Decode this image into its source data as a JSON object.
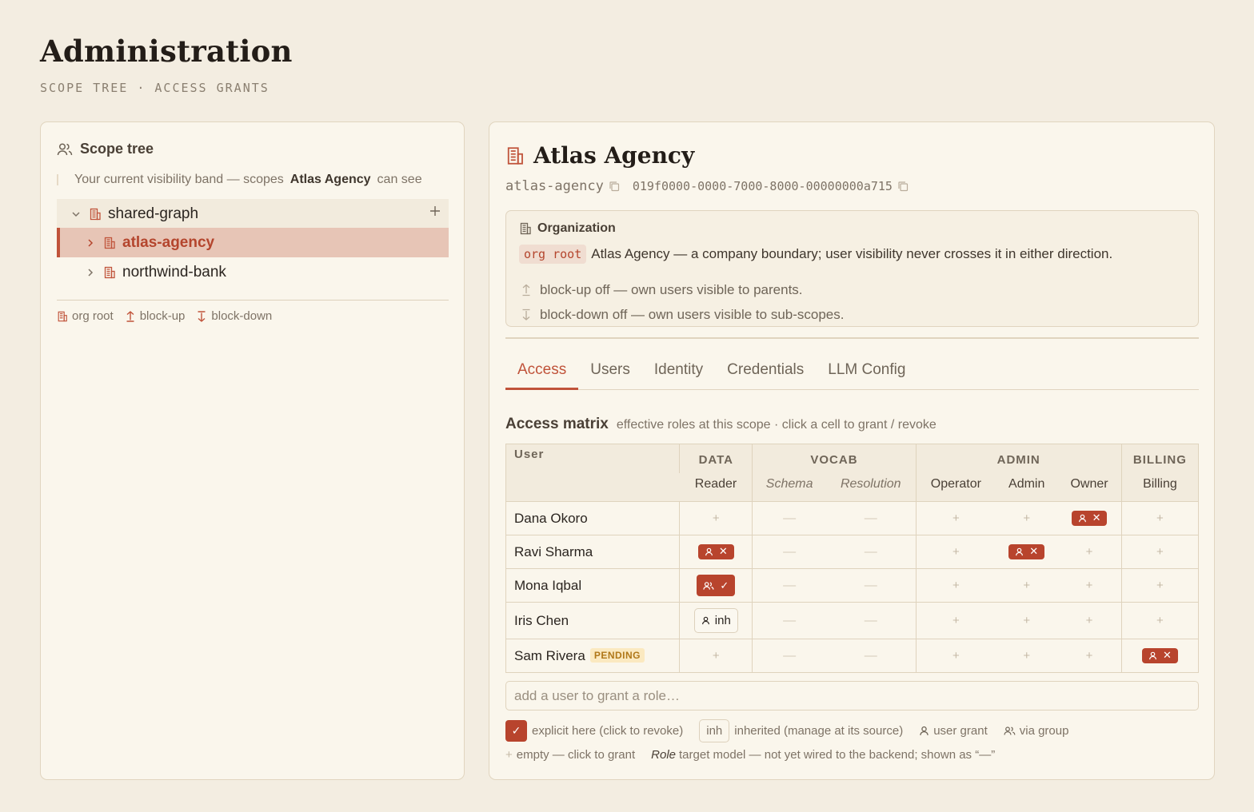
{
  "page": {
    "title": "Administration",
    "subtitle": "SCOPE TREE · ACCESS GRANTS"
  },
  "scope_tree": {
    "title": "Scope tree",
    "band_prefix": "Your current visibility band — scopes",
    "band_scope": "Atlas Agency",
    "band_suffix": "can see",
    "nodes": [
      {
        "label": "shared-graph",
        "expanded": true,
        "level": 0
      },
      {
        "label": "atlas-agency",
        "selected": true,
        "level": 1
      },
      {
        "label": "northwind-bank",
        "level": 1
      }
    ],
    "legend": {
      "org_root": "org root",
      "block_up": "block-up",
      "block_down": "block-down"
    }
  },
  "detail": {
    "title": "Atlas Agency",
    "slug": "atlas-agency",
    "uuid": "019f0000-0000-7000-8000-00000000a715",
    "org": {
      "heading": "Organization",
      "tag": "org root",
      "description": "Atlas Agency — a company boundary; user visibility never crosses it in either direction.",
      "block_up": "block-up off — own users visible to parents.",
      "block_down": "block-down off — own users visible to sub-scopes."
    },
    "tabs": [
      "Access",
      "Users",
      "Identity",
      "Credentials",
      "LLM Config"
    ],
    "active_tab": "Access",
    "matrix": {
      "title": "Access matrix",
      "subtitle": "effective roles at this scope · click a cell to grant / revoke",
      "user_header": "User",
      "groups": [
        "DATA",
        "VOCAB",
        "ADMIN",
        "BILLING"
      ],
      "roles": [
        "Reader",
        "Schema",
        "Resolution",
        "Operator",
        "Admin",
        "Owner",
        "Billing"
      ],
      "rows": [
        {
          "name": "Dana Okoro",
          "cells": [
            "+",
            "—",
            "—",
            "+",
            "+",
            "user-revoke",
            "+"
          ]
        },
        {
          "name": "Ravi Sharma",
          "cells": [
            "user-revoke",
            "—",
            "—",
            "+",
            "user-revoke",
            "+",
            "+"
          ]
        },
        {
          "name": "Mona Iqbal",
          "cells": [
            "group-check",
            "—",
            "—",
            "+",
            "+",
            "+",
            "+"
          ]
        },
        {
          "name": "Iris Chen",
          "cells": [
            "inh",
            "—",
            "—",
            "+",
            "+",
            "+",
            "+"
          ]
        },
        {
          "name": "Sam Rivera",
          "badge": "PENDING",
          "cells": [
            "+",
            "—",
            "—",
            "+",
            "+",
            "+",
            "user-revoke"
          ]
        }
      ],
      "add_placeholder": "add a user to grant a role…",
      "legend": {
        "check": "✓",
        "explicit": "explicit here (click to revoke)",
        "inh": "inh",
        "inherited": "inherited (manage at its source)",
        "user_grant": "user grant",
        "via_group": "via group",
        "plus": "+",
        "empty": "empty — click to grant",
        "role": "Role",
        "role_note": "target model — not yet wired to the backend; shown as “—”"
      }
    }
  },
  "colors": {
    "accent": "#b8442d",
    "background": "#f3ede1",
    "panel": "#faf6ec",
    "pending": "#fbe9c0"
  }
}
